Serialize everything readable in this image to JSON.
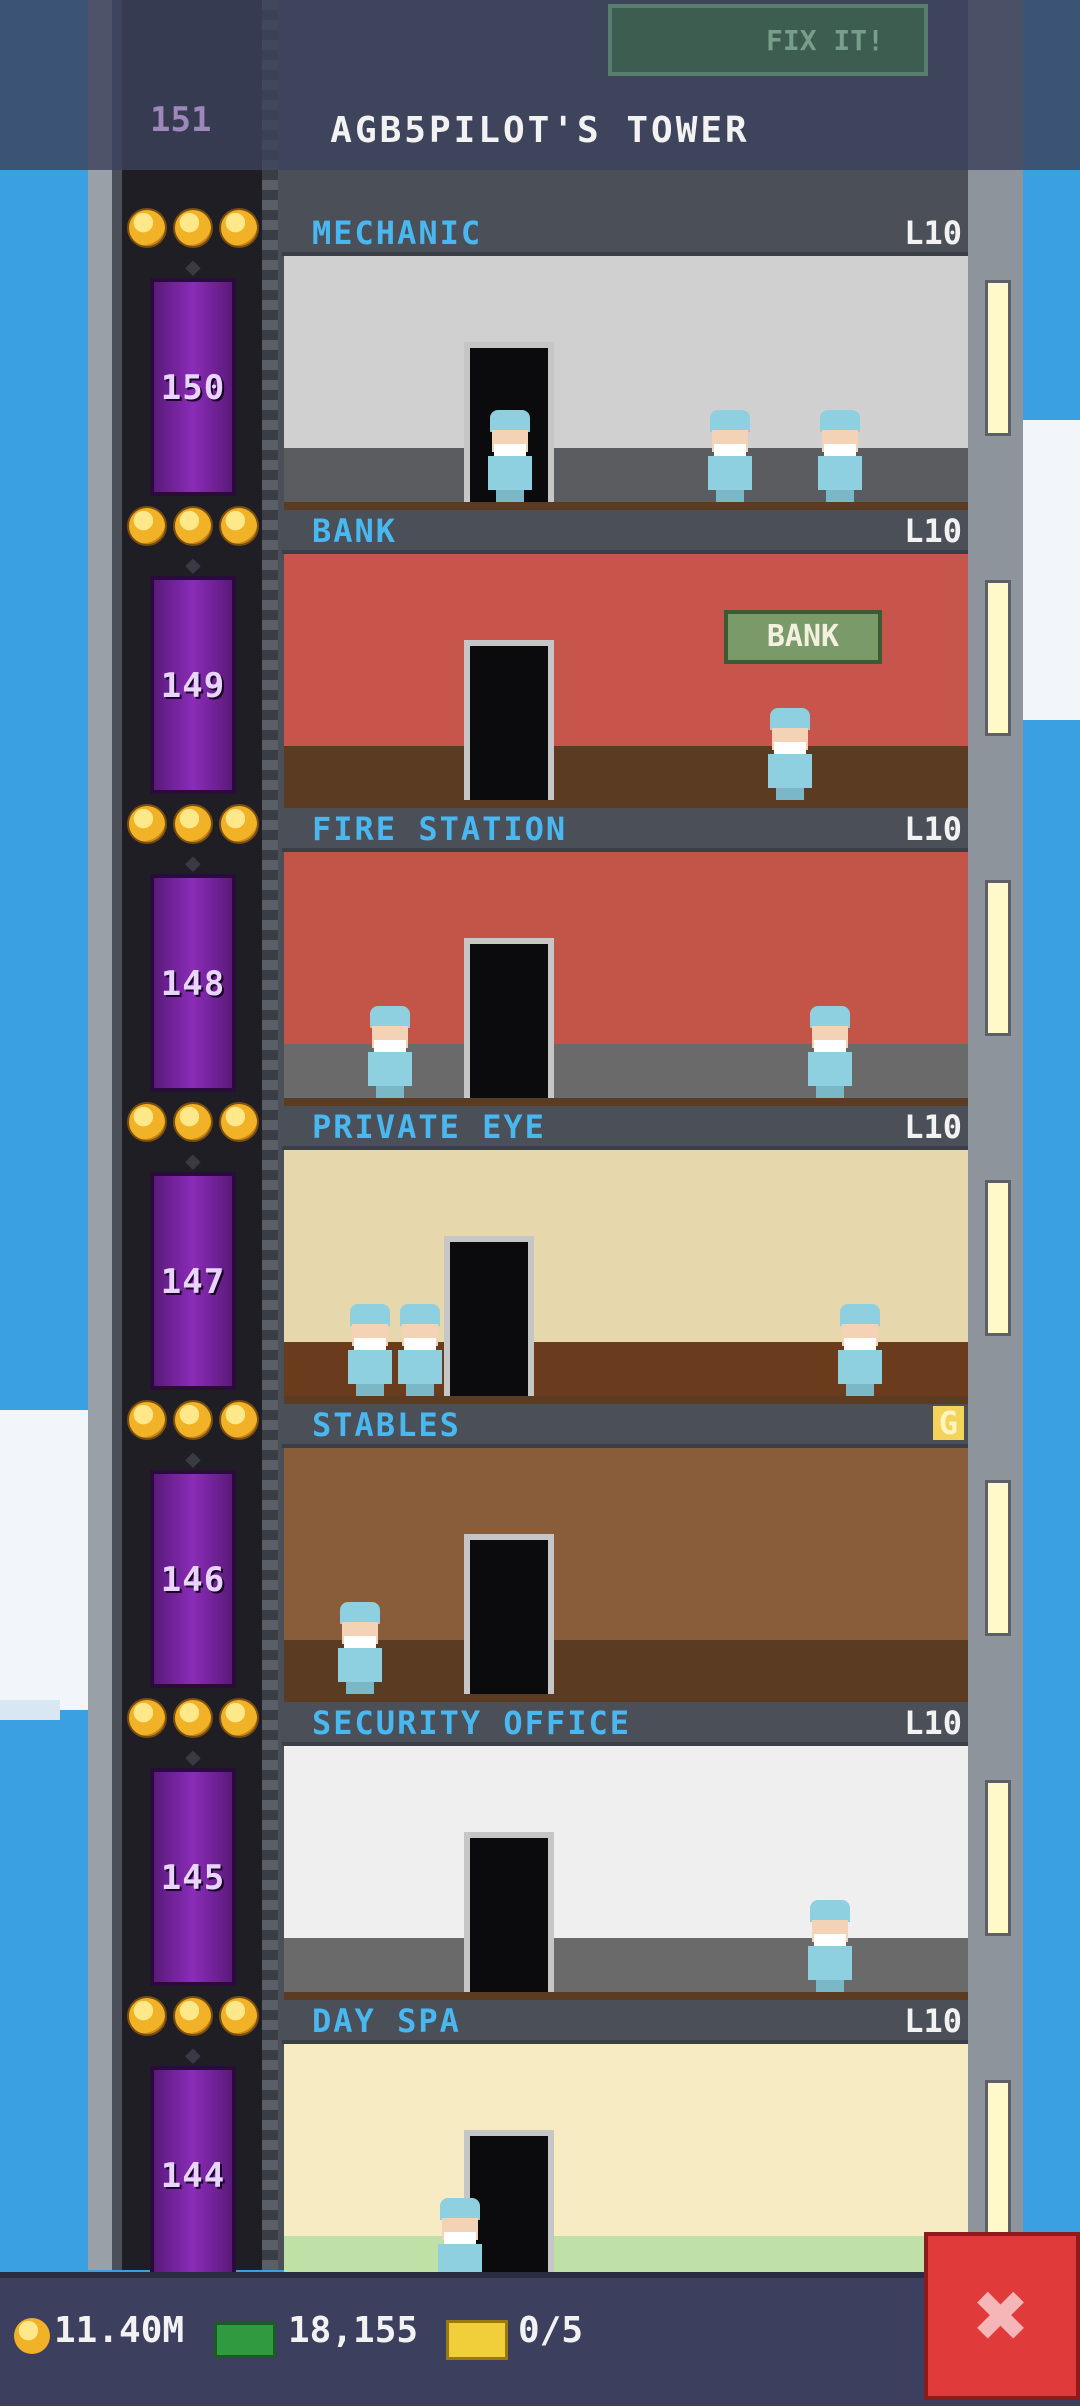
{
  "header": {
    "title": "AGB5PILOT'S TOWER",
    "fix_it_label": "FIX IT!",
    "top_floor_number": "151"
  },
  "floors": [
    {
      "name": "MECHANIC",
      "level": "L10",
      "number": "150",
      "bg": "#8b8e93",
      "wall": "#d0d0d0",
      "floor_color": "#5a5c60"
    },
    {
      "name": "BANK",
      "level": "L10",
      "number": "149",
      "bg": "#b64a40",
      "wall": "#c8554b",
      "floor_color": "#5b3c22",
      "sign": "BANK"
    },
    {
      "name": "FIRE STATION",
      "level": "L10",
      "number": "148",
      "bg": "#b0463a",
      "wall": "#c35448",
      "floor_color": "#6a6a6a"
    },
    {
      "name": "PRIVATE EYE",
      "level": "L10",
      "number": "147",
      "bg": "#efe2bf",
      "wall": "#e7d7ad",
      "floor_color": "#6b3b1e"
    },
    {
      "name": "STABLES",
      "level": "",
      "number": "146",
      "bg": "#7a5030",
      "wall": "#8a5d3a",
      "floor_color": "#5b3c22",
      "level_coin": "G"
    },
    {
      "name": "SECURITY OFFICE",
      "level": "L10",
      "number": "145",
      "bg": "#e4e4e4",
      "wall": "#efefef",
      "floor_color": "#6a6a6a"
    },
    {
      "name": "DAY SPA",
      "level": "L10",
      "number": "144",
      "bg": "#f3e4b2",
      "wall": "#f7ebc4",
      "floor_color": "#bfe0a6"
    }
  ],
  "hud": {
    "coins": "11.40M",
    "cash": "18,155",
    "tickets": "0/5"
  },
  "icons": {
    "coin": "coin-icon",
    "cash": "cash-icon",
    "ticket": "ticket-icon",
    "close": "close-icon",
    "star": "star-icon"
  },
  "colors": {
    "accent_label": "#4ab8f0",
    "elevator": "#8a2cb8",
    "close": "#e03a3a"
  }
}
